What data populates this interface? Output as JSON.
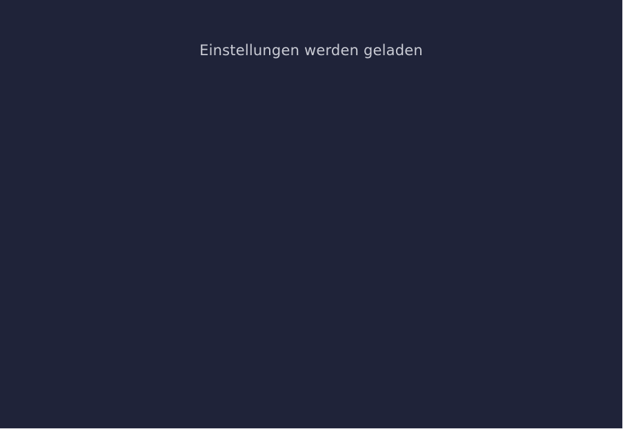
{
  "screen": {
    "background_color": "#1f2339",
    "text_color": "#c8cad3",
    "loading_message": "Einstellungen werden geladen"
  }
}
